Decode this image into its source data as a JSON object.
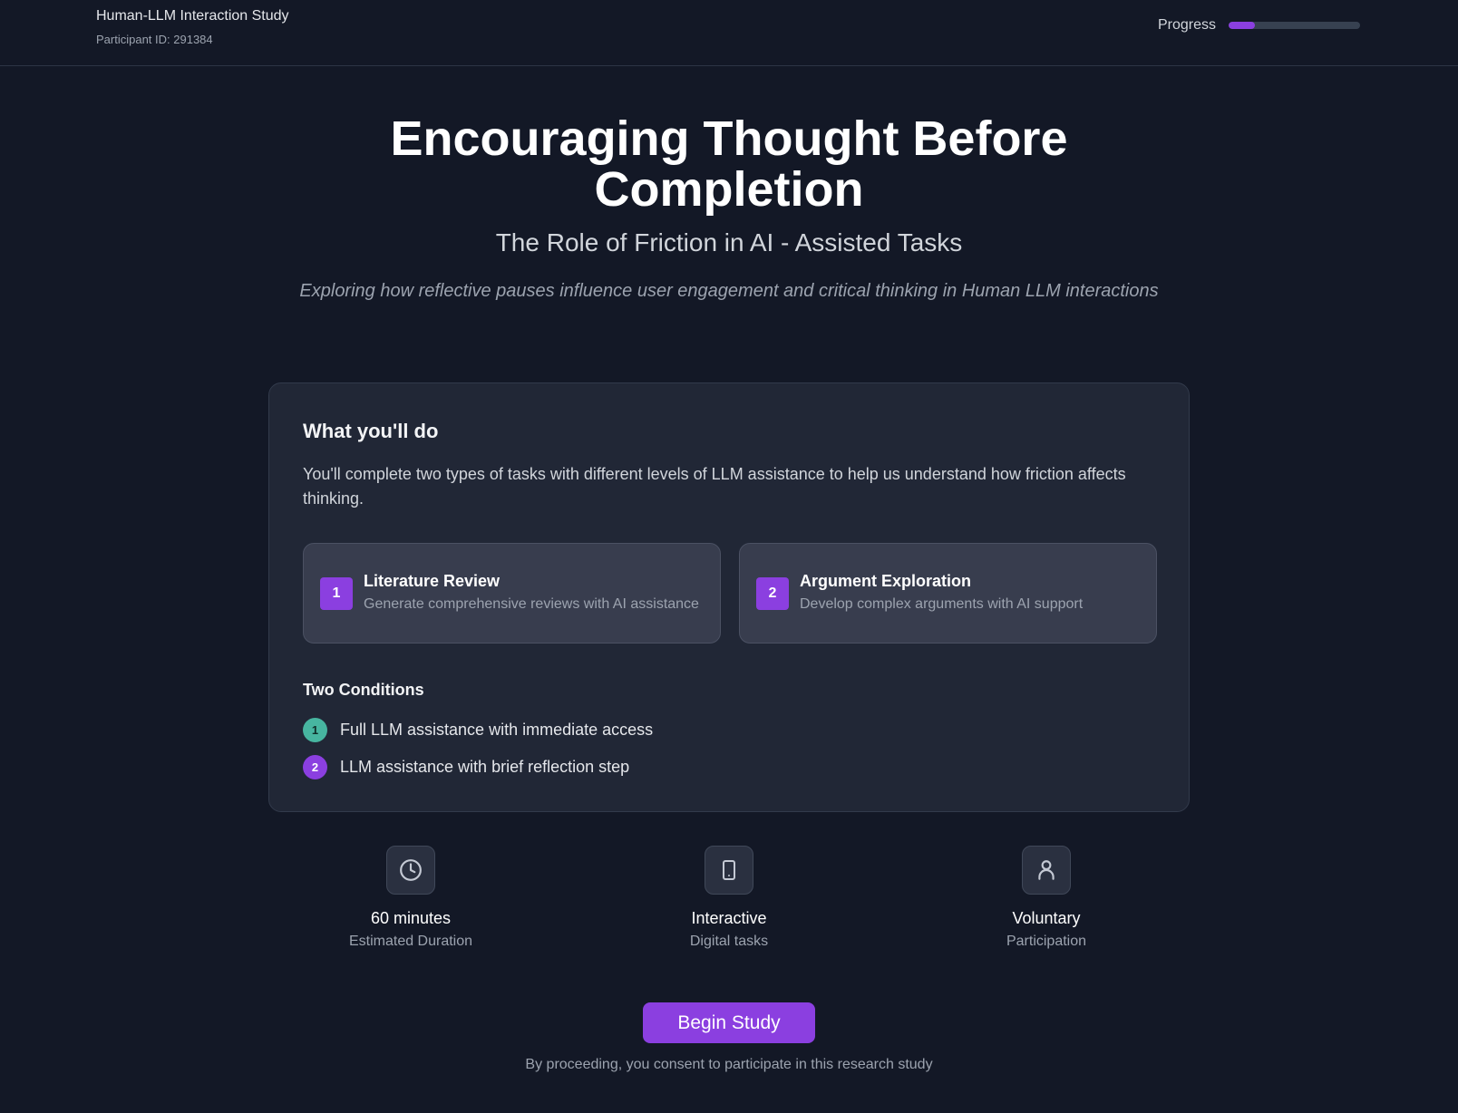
{
  "header": {
    "study_title": "Human-LLM Interaction Study",
    "participant_id": "Participant ID: 291384",
    "progress_label": "Progress",
    "progress_fraction": 0.2
  },
  "hero": {
    "title_line1": "Encouraging Thought Before",
    "title_line2": "Completion",
    "subtitle": "The Role of Friction in AI - Assisted Tasks",
    "description": "Exploring how reflective pauses influence user engagement and critical thinking in Human LLM interactions"
  },
  "card": {
    "heading": "What you'll do",
    "text": "You'll complete two types of tasks with different levels of LLM assistance to help us understand how friction affects thinking.",
    "tasks": [
      {
        "number": "1",
        "title": "Literature Review",
        "description": "Generate comprehensive reviews with AI assistance"
      },
      {
        "number": "2",
        "title": "Argument Exploration",
        "description": "Develop complex arguments with AI support"
      }
    ],
    "conditions_heading": "Two Conditions",
    "conditions": [
      {
        "number": "1",
        "text": "Full LLM assistance with immediate access",
        "color": "#47b5a0"
      },
      {
        "number": "2",
        "text": "LLM assistance with brief reflection step",
        "color": "#8b3fe0"
      }
    ]
  },
  "features": [
    {
      "icon": "clock-icon",
      "title": "60 minutes",
      "subtitle": "Estimated Duration"
    },
    {
      "icon": "tablet-icon",
      "title": "Interactive",
      "subtitle": "Digital tasks"
    },
    {
      "icon": "person-icon",
      "title": "Voluntary",
      "subtitle": "Participation"
    }
  ],
  "cta": {
    "button_label": "Begin Study",
    "consent_text": "By proceeding, you consent to participate in this research study"
  },
  "colors": {
    "background": "#131826",
    "card": "#212736",
    "accent": "#8b3fe0",
    "teal": "#47b5a0"
  }
}
